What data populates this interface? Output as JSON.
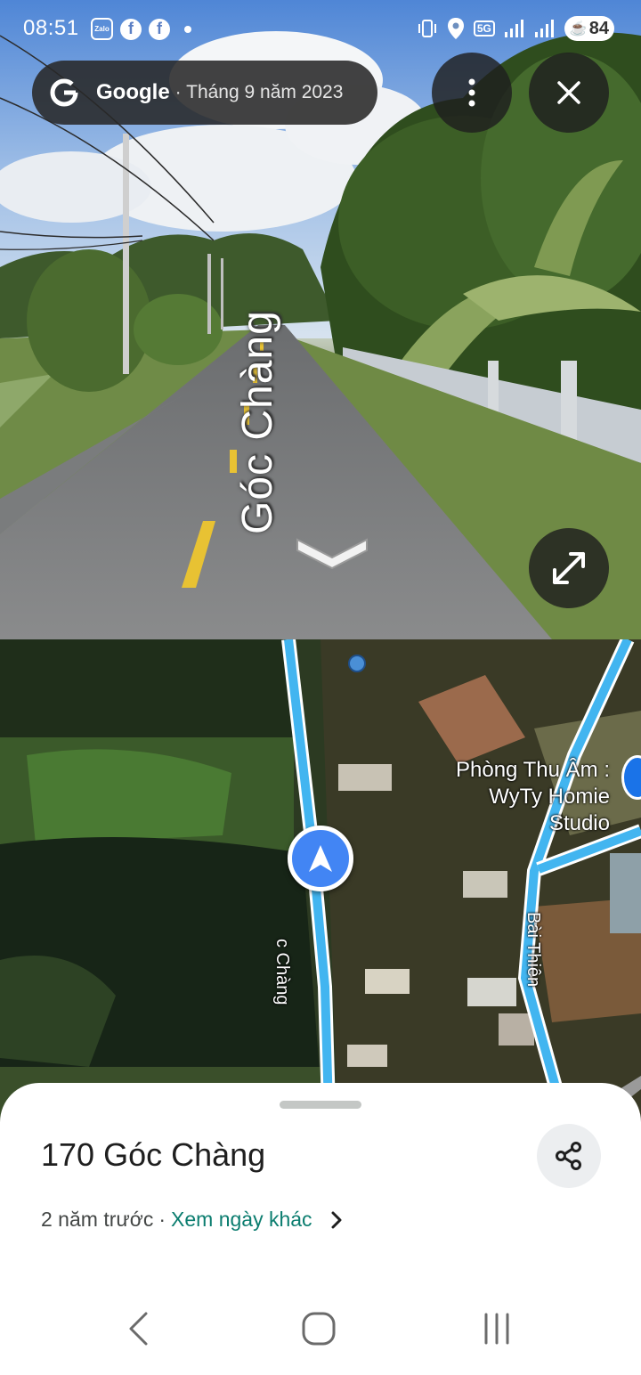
{
  "status_bar": {
    "time": "08:51",
    "battery": "84",
    "app_icons": [
      "zalo-icon",
      "facebook-icon",
      "facebook-icon"
    ],
    "network": "5G"
  },
  "streetview": {
    "brand": "Google",
    "capture_date": "· Tháng 9 năm 2023",
    "road_overlay_label": "Góc Chàng",
    "more_icon": "more-vert-icon",
    "close_icon": "close-icon",
    "expand_icon": "expand-icon"
  },
  "map": {
    "poi_name_line1": "Phòng Thu Âm :",
    "poi_name_line2": "WyTy Homie Studio",
    "road_1": "c Chàng",
    "road_2": "Bài Thiên",
    "road_color": "#42b5f0"
  },
  "sheet": {
    "title": "170 Góc Chàng",
    "age": "2 năm trước",
    "separator": "·",
    "other_dates_link": "Xem ngày khác",
    "link_color": "#0b7d6f"
  },
  "nav": {
    "back": "back-icon",
    "home": "home-icon",
    "recents": "recents-icon"
  }
}
